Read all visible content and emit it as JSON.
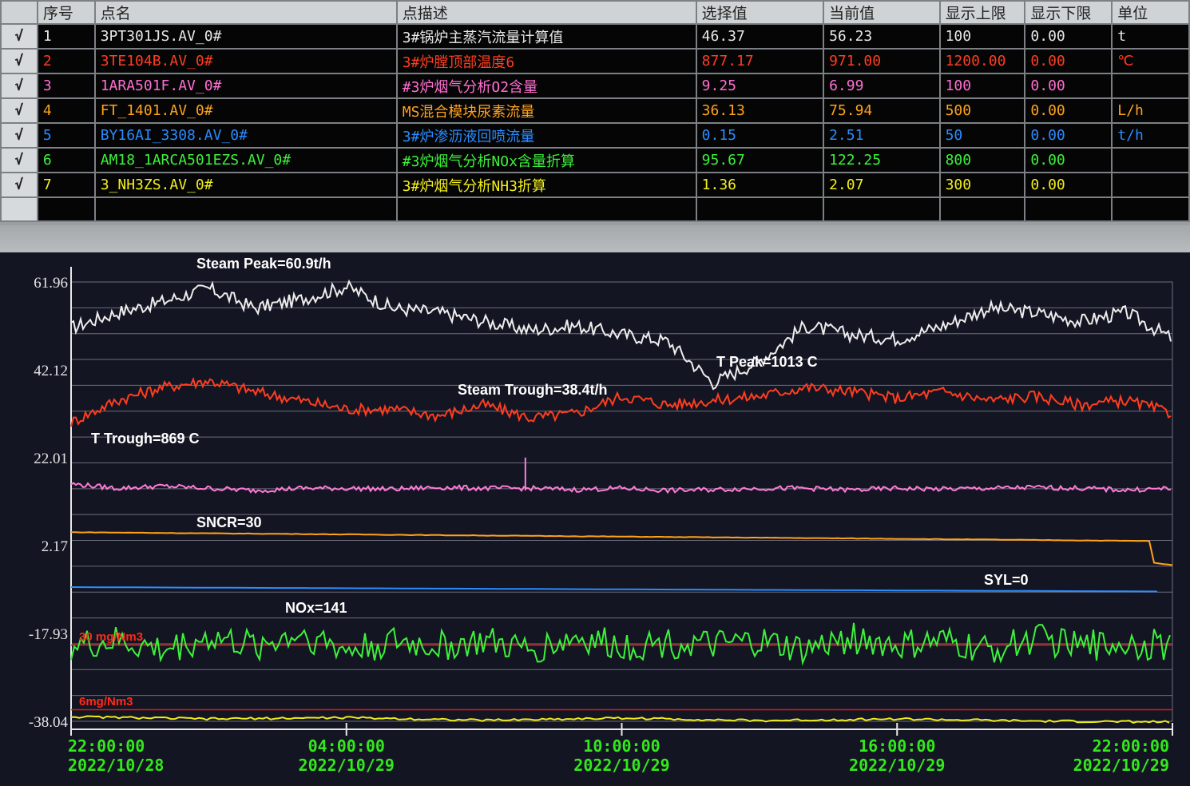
{
  "table": {
    "headers": [
      "",
      "序号",
      "点名",
      "点描述",
      "选择值",
      "当前值",
      "显示上限",
      "显示下限",
      "单位"
    ],
    "rows": [
      {
        "check": "√",
        "no": "1",
        "name": "3PT301JS.AV_0#",
        "desc": "3#锅炉主蒸汽流量计算值",
        "sel": "46.37",
        "cur": "56.23",
        "hi": "100",
        "lo": "0.00",
        "unit": "t",
        "color": "#e8e8e8"
      },
      {
        "check": "√",
        "no": "2",
        "name": "3TE104B.AV_0#",
        "desc": "3#炉膛顶部温度6",
        "sel": "877.17",
        "cur": "971.00",
        "hi": "1200.00",
        "lo": "0.00",
        "unit": "℃",
        "color": "#ff3d1f"
      },
      {
        "check": "√",
        "no": "3",
        "name": "1ARA501F.AV_0#",
        "desc": "#3炉烟气分析O2含量",
        "sel": "9.25",
        "cur": "6.99",
        "hi": "100",
        "lo": "0.00",
        "unit": "",
        "color": "#ff6fd2"
      },
      {
        "check": "√",
        "no": "4",
        "name": "FT_1401.AV_0#",
        "desc": "MS混合模块尿素流量",
        "sel": "36.13",
        "cur": "75.94",
        "hi": "500",
        "lo": "0.00",
        "unit": "L/h",
        "color": "#ffa21a"
      },
      {
        "check": "√",
        "no": "5",
        "name": "BY16AI_3308.AV_0#",
        "desc": "3#炉渗沥液回喷流量",
        "sel": "0.15",
        "cur": "2.51",
        "hi": "50",
        "lo": "0.00",
        "unit": "t/h",
        "color": "#2a8cff"
      },
      {
        "check": "√",
        "no": "6",
        "name": "AM18_1ARCA501EZS.AV_0#",
        "desc": "#3炉烟气分析NOx含量折算",
        "sel": "95.67",
        "cur": "122.25",
        "hi": "800",
        "lo": "0.00",
        "unit": "",
        "color": "#3cf23a"
      },
      {
        "check": "√",
        "no": "7",
        "name": "3_NH3ZS.AV_0#",
        "desc": "3#炉烟气分析NH3折算",
        "sel": "1.36",
        "cur": "2.07",
        "hi": "300",
        "lo": "0.00",
        "unit": "",
        "color": "#f2f01c"
      }
    ]
  },
  "chart_data": {
    "type": "line",
    "y_ticks": [
      "61.96",
      "42.12",
      "22.01",
      "2.17",
      "-17.93",
      "-38.04"
    ],
    "ylim": [
      -38.04,
      61.96
    ],
    "x_ticks": [
      {
        "time": "22:00:00",
        "date": "2022/10/28"
      },
      {
        "time": "04:00:00",
        "date": "2022/10/29"
      },
      {
        "time": "10:00:00",
        "date": "2022/10/29"
      },
      {
        "time": "16:00:00",
        "date": "2022/10/29"
      },
      {
        "time": "22:00:00",
        "date": "2022/10/29"
      }
    ],
    "grid": true,
    "annotations": {
      "steam_peak": "Steam Peak=60.9t/h",
      "steam_trough": "Steam Trough=38.4t/h",
      "t_peak": "T Peak=1013 C",
      "t_trough": "T Trough=869 C",
      "sncr": "SNCR=30",
      "syl": "SYL=0",
      "nox": "NOx=141",
      "limit_high": "30 mg/Nm3",
      "limit_low": "6mg/Nm3"
    },
    "series": [
      {
        "color": "#ededed",
        "hours": [
          0,
          1,
          2,
          3,
          4,
          5,
          6,
          7,
          8,
          9,
          10,
          11,
          12,
          13,
          14,
          15,
          16,
          17,
          18,
          19,
          20,
          21,
          22,
          23,
          24
        ],
        "values": [
          51.5,
          55,
          57.5,
          60.5,
          56,
          58,
          60.9,
          56,
          55,
          53,
          51,
          52,
          50,
          48.5,
          39,
          44,
          52,
          50,
          49,
          52,
          56,
          55,
          53,
          55,
          49
        ]
      },
      {
        "color": "#ff3d1f",
        "hours": [
          0,
          1,
          2,
          3,
          4,
          5,
          6,
          7,
          8,
          9,
          10,
          11,
          12,
          13,
          14,
          15,
          16,
          17,
          18,
          19,
          20,
          21,
          22,
          23,
          24
        ],
        "values": [
          30,
          35,
          38,
          39.5,
          37,
          35,
          33,
          33,
          31.5,
          34,
          31,
          32,
          36,
          34,
          35,
          36,
          38,
          37,
          35.5,
          37,
          35,
          36,
          34,
          35,
          32
        ]
      },
      {
        "color": "#ff7ad8",
        "hours": [
          0,
          1,
          2,
          3,
          4,
          5,
          6,
          7,
          8,
          9,
          10,
          11,
          12,
          13,
          14,
          15,
          16,
          17,
          18,
          19,
          20,
          21,
          22,
          23,
          24
        ],
        "values": [
          16,
          15,
          15.5,
          15,
          14.5,
          15,
          15,
          14.8,
          15.2,
          15,
          15,
          14.7,
          15,
          14.5,
          14.7,
          15,
          15,
          14.6,
          15,
          14.8,
          15,
          15.2,
          15,
          14.6,
          15
        ]
      },
      {
        "color": "#ffa21a",
        "hours": [
          0,
          6,
          12,
          18,
          23.5,
          23.6,
          24
        ],
        "values": [
          5,
          4.5,
          4,
          3.5,
          3,
          -2,
          -2.5
        ]
      },
      {
        "color": "#2a8cff",
        "hours": [
          0,
          24
        ],
        "values": [
          -7.5,
          -8.5
        ]
      },
      {
        "color": "#3cf23a",
        "hours": [
          0,
          1,
          2,
          3,
          4,
          5,
          6,
          7,
          8,
          9,
          10,
          11,
          12,
          13,
          14,
          15,
          16,
          17,
          18,
          19,
          20,
          21,
          22,
          23,
          24
        ],
        "values": [
          -21,
          -20,
          -22,
          -19,
          -21,
          -18,
          -22,
          -20,
          -21,
          -20,
          -22,
          -19,
          -21,
          -20,
          -21,
          -20,
          -22,
          -19,
          -21,
          -20,
          -22,
          -19,
          -21,
          -20,
          -21
        ]
      },
      {
        "color": "#eeea1a",
        "hours": [
          0,
          3,
          6,
          9,
          12,
          15,
          18,
          21,
          24
        ],
        "values": [
          -37,
          -37.5,
          -37.2,
          -37.8,
          -37.3,
          -37.9,
          -37.5,
          -38,
          -38.2
        ]
      }
    ],
    "reference_lines": [
      {
        "label": "30 mg/Nm3",
        "color": "#e01a14",
        "value": -20.7
      },
      {
        "label": "6mg/Nm3",
        "color": "#e01a14",
        "value": -35.4
      }
    ]
  }
}
